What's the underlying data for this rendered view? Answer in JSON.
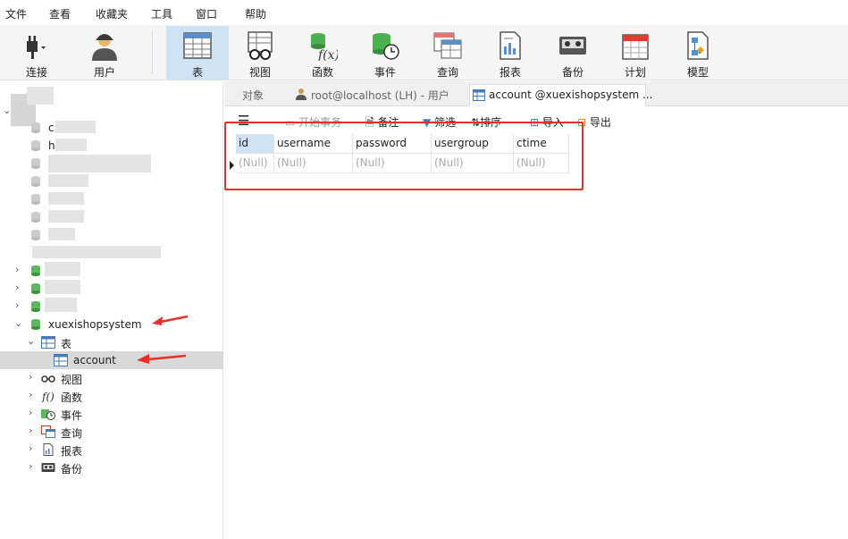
{
  "menu": [
    "文件",
    "查看",
    "收藏夹",
    "工具",
    "窗口",
    "帮助"
  ],
  "toolbar": {
    "connect": "连接",
    "user": "用户",
    "table": "表",
    "view": "视图",
    "function": "函数",
    "event": "事件",
    "query": "查询",
    "report": "报表",
    "backup": "备份",
    "schedule": "计划",
    "model": "模型"
  },
  "tabs": {
    "objects": "对象",
    "user_tab": "root@localhost (LH) - 用户",
    "table_tab": "account @xuexishopsystem ..."
  },
  "data_toolbar": {
    "begin_tx": "开始事务",
    "memo": "备注",
    "filter": "筛选",
    "sort": "排序",
    "import": "导入",
    "export": "导出"
  },
  "tree": {
    "database": "xuexishopsystem",
    "tables_folder": "表",
    "table_account": "account",
    "views": "视图",
    "functions": "函数",
    "events": "事件",
    "queries": "查询",
    "reports": "报表",
    "backups": "备份",
    "blurred_fragments": [
      "c",
      "h"
    ]
  },
  "grid": {
    "columns": [
      "id",
      "username",
      "password",
      "usergroup",
      "ctime"
    ],
    "row": [
      "(Null)",
      "(Null)",
      "(Null)",
      "(Null)",
      "(Null)"
    ]
  },
  "colors": {
    "accent": "#1e73be",
    "highlight": "#e8302a",
    "db_green": "#2e9e3e"
  }
}
